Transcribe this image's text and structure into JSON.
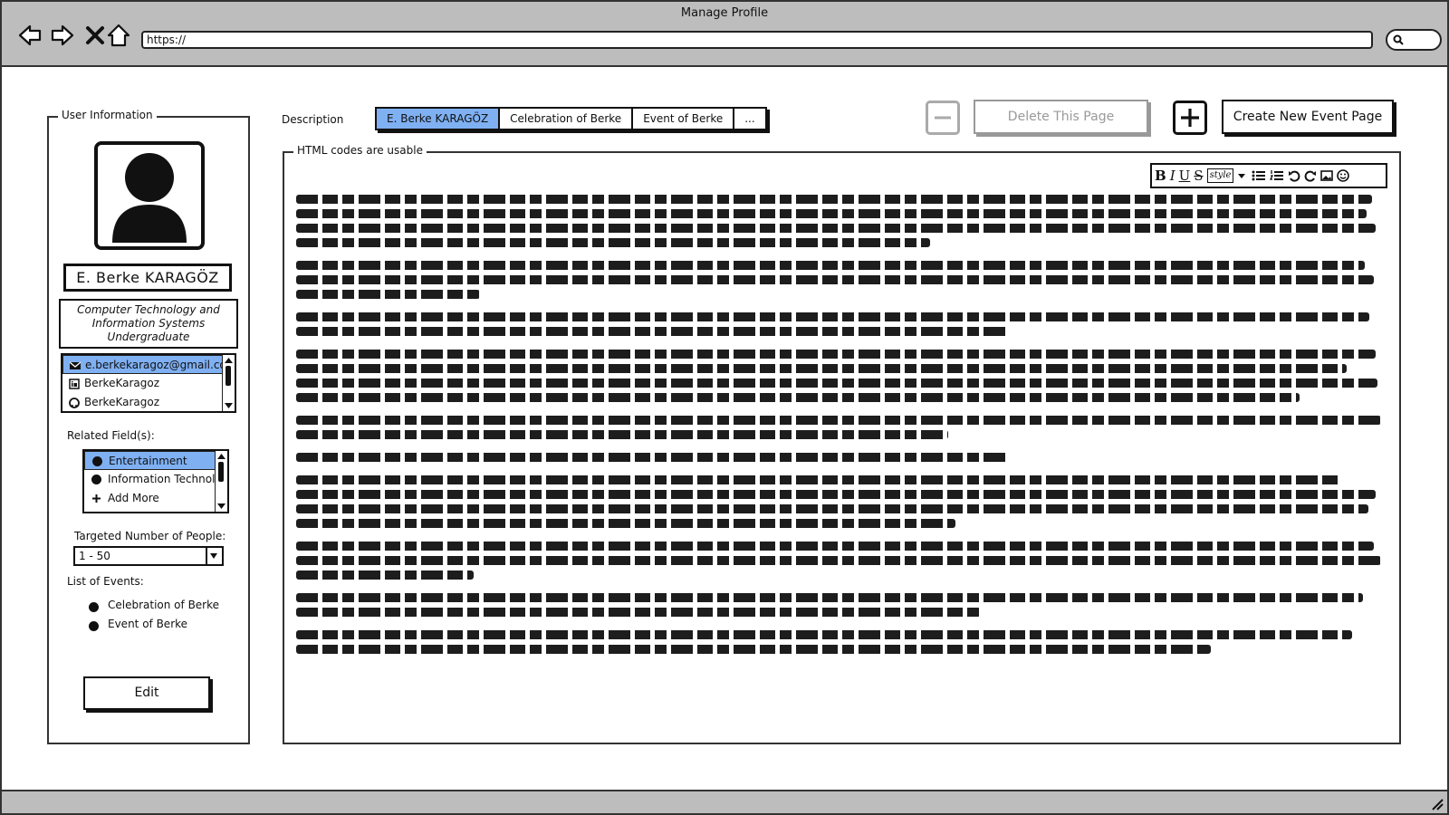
{
  "window": {
    "title": "Manage Profile",
    "url": "https://"
  },
  "user_info": {
    "legend": "User Information",
    "name": "E. Berke KARAGÖZ",
    "role": "Computer Technology and Information Systems Undergraduate",
    "contacts": [
      {
        "icon": "email-icon",
        "value": "e.berkekaragoz@gmail.com"
      },
      {
        "icon": "linkedin-icon",
        "value": "BerkeKaragoz"
      },
      {
        "icon": "github-icon",
        "value": "BerkeKaragoz"
      }
    ],
    "related_fields_label": "Related Field(s):",
    "related_fields": [
      "Entertainment",
      "Information Technology",
      "Add More"
    ],
    "targeted_label": "Targeted Number of People:",
    "targeted_value": "1 - 50",
    "events_label": "List of Events:",
    "events": [
      "Celebration of Berke",
      "Event of Berke"
    ],
    "edit_label": "Edit"
  },
  "description": {
    "label": "Description",
    "tabs": [
      "E. Berke KARAGÖZ",
      "Celebration of Berke",
      "Event of Berke",
      "..."
    ],
    "active_tab": 0,
    "delete_label": "Delete This Page",
    "create_label": "Create New Event Page",
    "editor_legend": "HTML codes are usable",
    "toolbar": [
      "B",
      "I",
      "U",
      "S",
      "style",
      "bulleted-list",
      "numbered-list",
      "undo",
      "redo",
      "image",
      "emoji"
    ]
  },
  "colors": {
    "selection": "#7fb0f2",
    "chrome": "#bdbdbd"
  }
}
